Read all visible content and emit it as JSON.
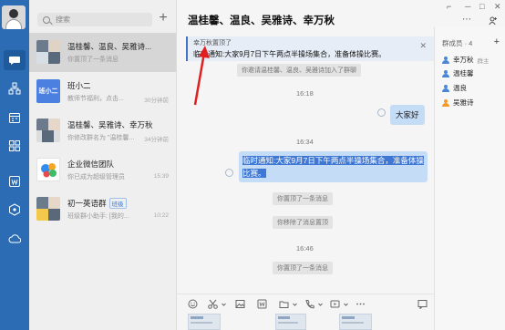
{
  "search": {
    "placeholder": "搜索"
  },
  "conversations": [
    {
      "title": "温桂馨、温良、吴雅诗...",
      "subtitle": "你置顶了一条消息",
      "time": ""
    },
    {
      "title": "班小二",
      "subtitle": "教师节福利，点击...",
      "time": "30分钟前"
    },
    {
      "title": "温桂馨、吴雅诗、幸万秋",
      "subtitle": "你修改群名为 \"温桂馨...",
      "time": "34分钟前"
    },
    {
      "title": "企业微信团队",
      "subtitle": "你已成为超级管理员",
      "time": "15:39"
    },
    {
      "title": "初一英语群",
      "tag": "班级",
      "subtitle": "班级群小助手: [我的...",
      "time": "10:22"
    }
  ],
  "chat": {
    "title": "温桂馨、温良、吴雅诗、幸万秋",
    "pinned": {
      "who": "幸万秋置顶了",
      "message": "临时通知:大家9月7日下午两点半操场集合，准备体操比赛。"
    },
    "system_invite": "你邀请温桂馨、温良、吴雅诗加入了群聊",
    "time1": "16:18",
    "msg1": "大家好",
    "time2": "16:34",
    "msg2": "临时通知:大家9月7日下午两点半操场集合，准备体操比赛。",
    "sys_pin1": "你置顶了一条消息",
    "sys_unpin": "你移除了消息置顶",
    "time3": "16:46",
    "sys_pin2": "你置顶了一条消息"
  },
  "members": {
    "header": "群成员 · 4",
    "list": [
      {
        "name": "幸万秋",
        "owner": "群主",
        "color": "#4a86d8"
      },
      {
        "name": "温桂馨",
        "owner": "",
        "color": "#4a86d8"
      },
      {
        "name": "温良",
        "owner": "",
        "color": "#4a86d8"
      },
      {
        "name": "吴雅诗",
        "owner": "",
        "color": "#f39a2b"
      }
    ]
  },
  "colors": {
    "rail": "#2b6cb4",
    "accent": "#3e78d4",
    "bubble": "#c5dcf6"
  }
}
